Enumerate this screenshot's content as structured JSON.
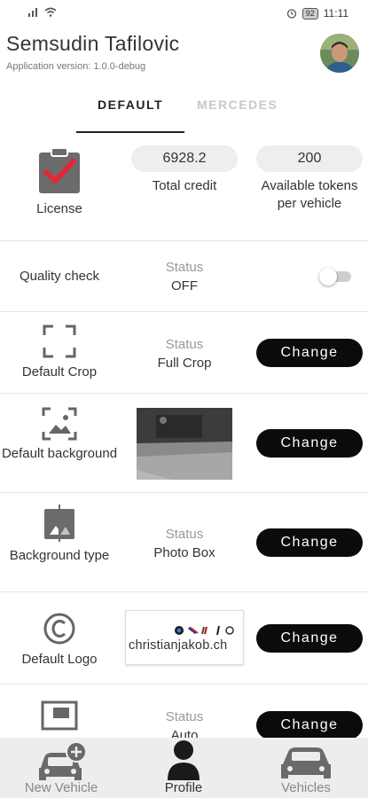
{
  "status_bar": {
    "time": "11:11",
    "battery": "92"
  },
  "header": {
    "name": "Semsudin Tafilovic",
    "app_version": "Application version: 1.0.0-debug"
  },
  "tabs": [
    {
      "label": "DEFAULT",
      "active": true
    },
    {
      "label": "MERCEDES",
      "active": false
    }
  ],
  "license": {
    "label": "License",
    "total_credit_value": "6928.2",
    "total_credit_label": "Total credit",
    "tokens_value": "200",
    "tokens_label": "Available tokens per vehicle"
  },
  "quality_check": {
    "label": "Quality check",
    "status_label": "Status",
    "status_value": "OFF",
    "toggle_on": false
  },
  "default_crop": {
    "label": "Default Crop",
    "status_label": "Status",
    "status_value": "Full Crop",
    "button_label": "Change"
  },
  "default_background": {
    "label": "Default background",
    "button_label": "Change"
  },
  "background_type": {
    "label": "Background type",
    "status_label": "Status",
    "status_value": "Photo Box",
    "button_label": "Change"
  },
  "default_logo": {
    "label": "Default Logo",
    "logo_text": "christianjakob.ch",
    "button_label": "Change"
  },
  "last_row": {
    "status_label": "Status",
    "status_value": "Auto",
    "button_label": "Change"
  },
  "bottom_nav": [
    {
      "label": "New Vehicle",
      "icon": "car-add-icon",
      "active": false
    },
    {
      "label": "Profile",
      "icon": "person-icon",
      "active": true
    },
    {
      "label": "Vehicles",
      "icon": "car-icon",
      "active": false
    }
  ],
  "colors": {
    "button": "#0b0b0b",
    "license_check": "#e0283c",
    "muted": "#999999"
  }
}
